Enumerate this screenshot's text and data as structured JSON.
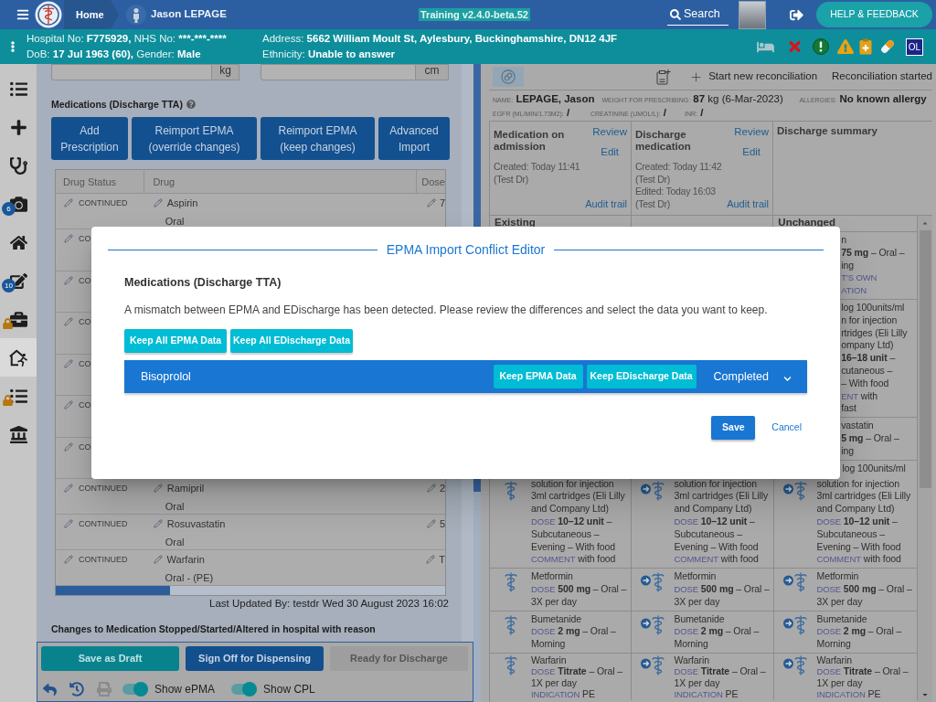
{
  "header": {
    "home": "Home",
    "patient_name": "Jason LEPAGE",
    "environment": "Training v2.4.0-beta.52",
    "search": "Search",
    "help": "HELP & FEEDBACK"
  },
  "patient_banner": {
    "left": [
      [
        {
          "label": "Hospital No:",
          "value": "F775929,"
        },
        {
          "label": "NHS No:",
          "value": "***-***-****"
        }
      ],
      [
        {
          "label": "DoB:",
          "value": "17 Jul 1963 (60),"
        },
        {
          "label": "Gender:",
          "value": "Male"
        }
      ]
    ],
    "right": [
      [
        {
          "label": "Address:",
          "value": "5662 William Moult St, Aylesbury, Buckinghamshire, DN12 4JF"
        }
      ],
      [
        {
          "label": "Ethnicity:",
          "value": "Unable to answer"
        }
      ]
    ],
    "flag": "OL"
  },
  "sidebar": {
    "items": [
      {
        "selected": false,
        "locked": false
      },
      {
        "selected": false,
        "locked": false
      },
      {
        "selected": false,
        "locked": false
      },
      {
        "selected": false,
        "locked": false,
        "badge": "6"
      },
      {
        "selected": false,
        "locked": false
      },
      {
        "selected": false,
        "locked": false,
        "badge": "10"
      },
      {
        "selected": false,
        "locked": true
      },
      {
        "selected": true,
        "locked": false
      },
      {
        "selected": false,
        "locked": true
      },
      {
        "selected": false,
        "locked": false
      }
    ]
  },
  "left_panel": {
    "weight_unit": "kg",
    "height_unit": "cm",
    "title": "Medications (Discharge TTA)",
    "actions": [
      "Add Prescription",
      "Reimport EPMA (override changes)",
      "Reimport EPMA (keep changes)",
      "Advanced Import"
    ],
    "table": {
      "columns": [
        "Drug Status",
        "Drug",
        "Dose"
      ],
      "rows": [
        {
          "status": "CONTINUED",
          "drug": "Aspirin",
          "route": "Oral",
          "dose": "7"
        },
        {
          "status": "CO"
        },
        {
          "status": "CO"
        },
        {
          "status": "CO"
        },
        {
          "status": "CO"
        },
        {
          "status": "CO"
        },
        {
          "status": "CO"
        },
        {
          "status": "CONTINUED",
          "drug": "Ramipril",
          "route": "Oral",
          "dose": "2"
        },
        {
          "status": "CONTINUED",
          "drug": "Rosuvastatin",
          "route": "Oral",
          "dose": "5"
        },
        {
          "status": "CONTINUED",
          "drug": "Warfarin",
          "route": "Oral - (PE)",
          "dose": "T"
        }
      ]
    },
    "last_updated": "Last Updated By: testdr Wed 30 August 2023 16:02",
    "changes_title": "Changes to Medication Stopped/Started/Altered in hospital with reason"
  },
  "footer": {
    "buttons": [
      {
        "label": "Save as Draft",
        "kind": "secondary",
        "disabled": false
      },
      {
        "label": "Sign Off for Dispensing",
        "kind": "primary",
        "disabled": false
      },
      {
        "label": "Ready for Discharge",
        "kind": "primary",
        "disabled": true
      }
    ],
    "toggles": [
      {
        "label": "Show ePMA",
        "on": true
      },
      {
        "label": "Show CPL",
        "on": true
      }
    ]
  },
  "right_panel": {
    "toolbar": {
      "start": "Start new reconciliation",
      "status": "Reconciliation started"
    },
    "patient_info": [
      {
        "label": "NAME:",
        "value": "LEPAGE, Jason"
      },
      {
        "label": "WEIGHT FOR PRESCRIBING:",
        "value": "87",
        "note": "kg (6-Mar-2023)"
      },
      {
        "label": "ALLERGIES:",
        "value": "No known allergy"
      }
    ],
    "labs": [
      {
        "label": "EGFR (ML/MIN/1.73M2):",
        "value": "/"
      },
      {
        "label": "CREATININE (UMOL/L):",
        "value": "/"
      },
      {
        "label": "INR:",
        "value": "/"
      }
    ],
    "cards": [
      {
        "title": "Medication on admission",
        "review": "Review",
        "edit": "Edit",
        "history": [
          "Created: Today 11:41 (Test Dr)"
        ],
        "audit": "Audit trail"
      },
      {
        "title": "Discharge medication",
        "review": "Review",
        "edit": "Edit",
        "history": [
          "Created: Today 11:42 (Test Dr)",
          "Edited: Today 16:03 (Test Dr)"
        ],
        "audit": "Audit trail"
      },
      {
        "title": "Discharge summary"
      }
    ],
    "grid": {
      "headers": {
        "left": "Existing",
        "right": "Unchanged"
      },
      "covered_rows": [
        {
          "fragments": [
            {
              "text": "n"
            },
            {
              "text": "**75 mg** – Oral –"
            },
            {
              "text": "ing"
            },
            {
              "label": "T'S OWN"
            },
            {
              "label": "ATION"
            }
          ]
        },
        {
          "fragments": [
            {
              "text": "log 100units/ml"
            },
            {
              "text": "n for injection"
            },
            {
              "text": "rtridges (Eli Lilly"
            },
            {
              "text": "ompany Ltd)"
            },
            {
              "text": "**16–18 unit** –"
            },
            {
              "text": "cutaneous –"
            },
            {
              "text": "– With food"
            },
            {
              "label": "ENT",
              "text": "with"
            },
            {
              "text": "fast"
            }
          ]
        },
        {
          "fragments": [
            {
              "text": "vastatin"
            },
            {
              "text": "**5 mg** – Oral –"
            },
            {
              "text": "ing"
            }
          ]
        }
      ],
      "rows": [
        {
          "cells": [
            {
              "linked": false,
              "name": "solution for injection 3ml cartridges (Eli Lilly and Company Ltd)",
              "details": [
                {
                  "label": "DOSE",
                  "text": "**10–12 unit** – Subcutaneous – Evening – With food"
                },
                {
                  "label": "COMMENT",
                  "text": "with food"
                }
              ]
            },
            {
              "linked": true,
              "name": "solution for injection 3ml cartridges (Eli Lilly and Company Ltd)",
              "details": [
                {
                  "label": "DOSE",
                  "text": "**10–12 unit** – Subcutaneous – Evening – With food"
                },
                {
                  "label": "COMMENT",
                  "text": "with food"
                }
              ]
            },
            {
              "linked": true,
              "fragment": "log 100units/ml",
              "name": "solution for injection 3ml cartridges (Eli Lilly and Company Ltd)",
              "details": [
                {
                  "label": "DOSE",
                  "text": "**10–12 unit** – Subcutaneous – Evening – With food"
                },
                {
                  "label": "COMMENT",
                  "text": "with food"
                }
              ]
            }
          ]
        },
        {
          "cells": [
            {
              "linked": false,
              "name": "Metformin",
              "details": [
                {
                  "label": "DOSE",
                  "text": "**500 mg** – Oral – 3X per day"
                }
              ]
            },
            {
              "linked": true,
              "name": "Metformin",
              "details": [
                {
                  "label": "DOSE",
                  "text": "**500 mg** – Oral – 3X per day"
                }
              ]
            },
            {
              "linked": true,
              "name": "Metformin",
              "details": [
                {
                  "label": "DOSE",
                  "text": "**500 mg** – Oral – 3X per day"
                }
              ]
            }
          ]
        },
        {
          "cells": [
            {
              "linked": false,
              "name": "Bumetanide",
              "details": [
                {
                  "label": "DOSE",
                  "text": "**2 mg** – Oral – Morning"
                }
              ]
            },
            {
              "linked": true,
              "name": "Bumetanide",
              "details": [
                {
                  "label": "DOSE",
                  "text": "**2 mg** – Oral – Morning"
                }
              ]
            },
            {
              "linked": true,
              "name": "Bumetanide",
              "details": [
                {
                  "label": "DOSE",
                  "text": "**2 mg** – Oral – Morning"
                }
              ]
            }
          ]
        },
        {
          "cells": [
            {
              "linked": false,
              "name": "Warfarin",
              "details": [
                {
                  "label": "DOSE",
                  "text": "**Titrate** – Oral – 1X per day"
                },
                {
                  "label": "INDICATION",
                  "text": "PE"
                }
              ]
            },
            {
              "linked": true,
              "name": "Warfarin",
              "details": [
                {
                  "label": "DOSE",
                  "text": "**Titrate** – Oral – 1X per day"
                },
                {
                  "label": "INDICATION",
                  "text": "PE"
                }
              ]
            },
            {
              "linked": true,
              "name": "Warfarin",
              "details": [
                {
                  "label": "DOSE",
                  "text": "**Titrate** – Oral – 1X per day"
                },
                {
                  "label": "INDICATION",
                  "text": "PE"
                }
              ]
            }
          ]
        }
      ]
    }
  },
  "modal": {
    "title": "EPMA Import Conflict Editor",
    "section": "Medications (Discharge TTA)",
    "message": "A mismatch between EPMA and EDischarge has been detected. Please review the differences and select the data you want to keep.",
    "bulk_actions": [
      "Keep All EPMA Data",
      "Keep All EDischarge Data"
    ],
    "conflicts": [
      {
        "drug": "Bisoprolol",
        "actions": [
          "Keep EPMA Data",
          "Keep EDischarge Data"
        ],
        "status": "Completed",
        "expanded": false
      }
    ],
    "save": "Save",
    "cancel": "Cancel"
  }
}
